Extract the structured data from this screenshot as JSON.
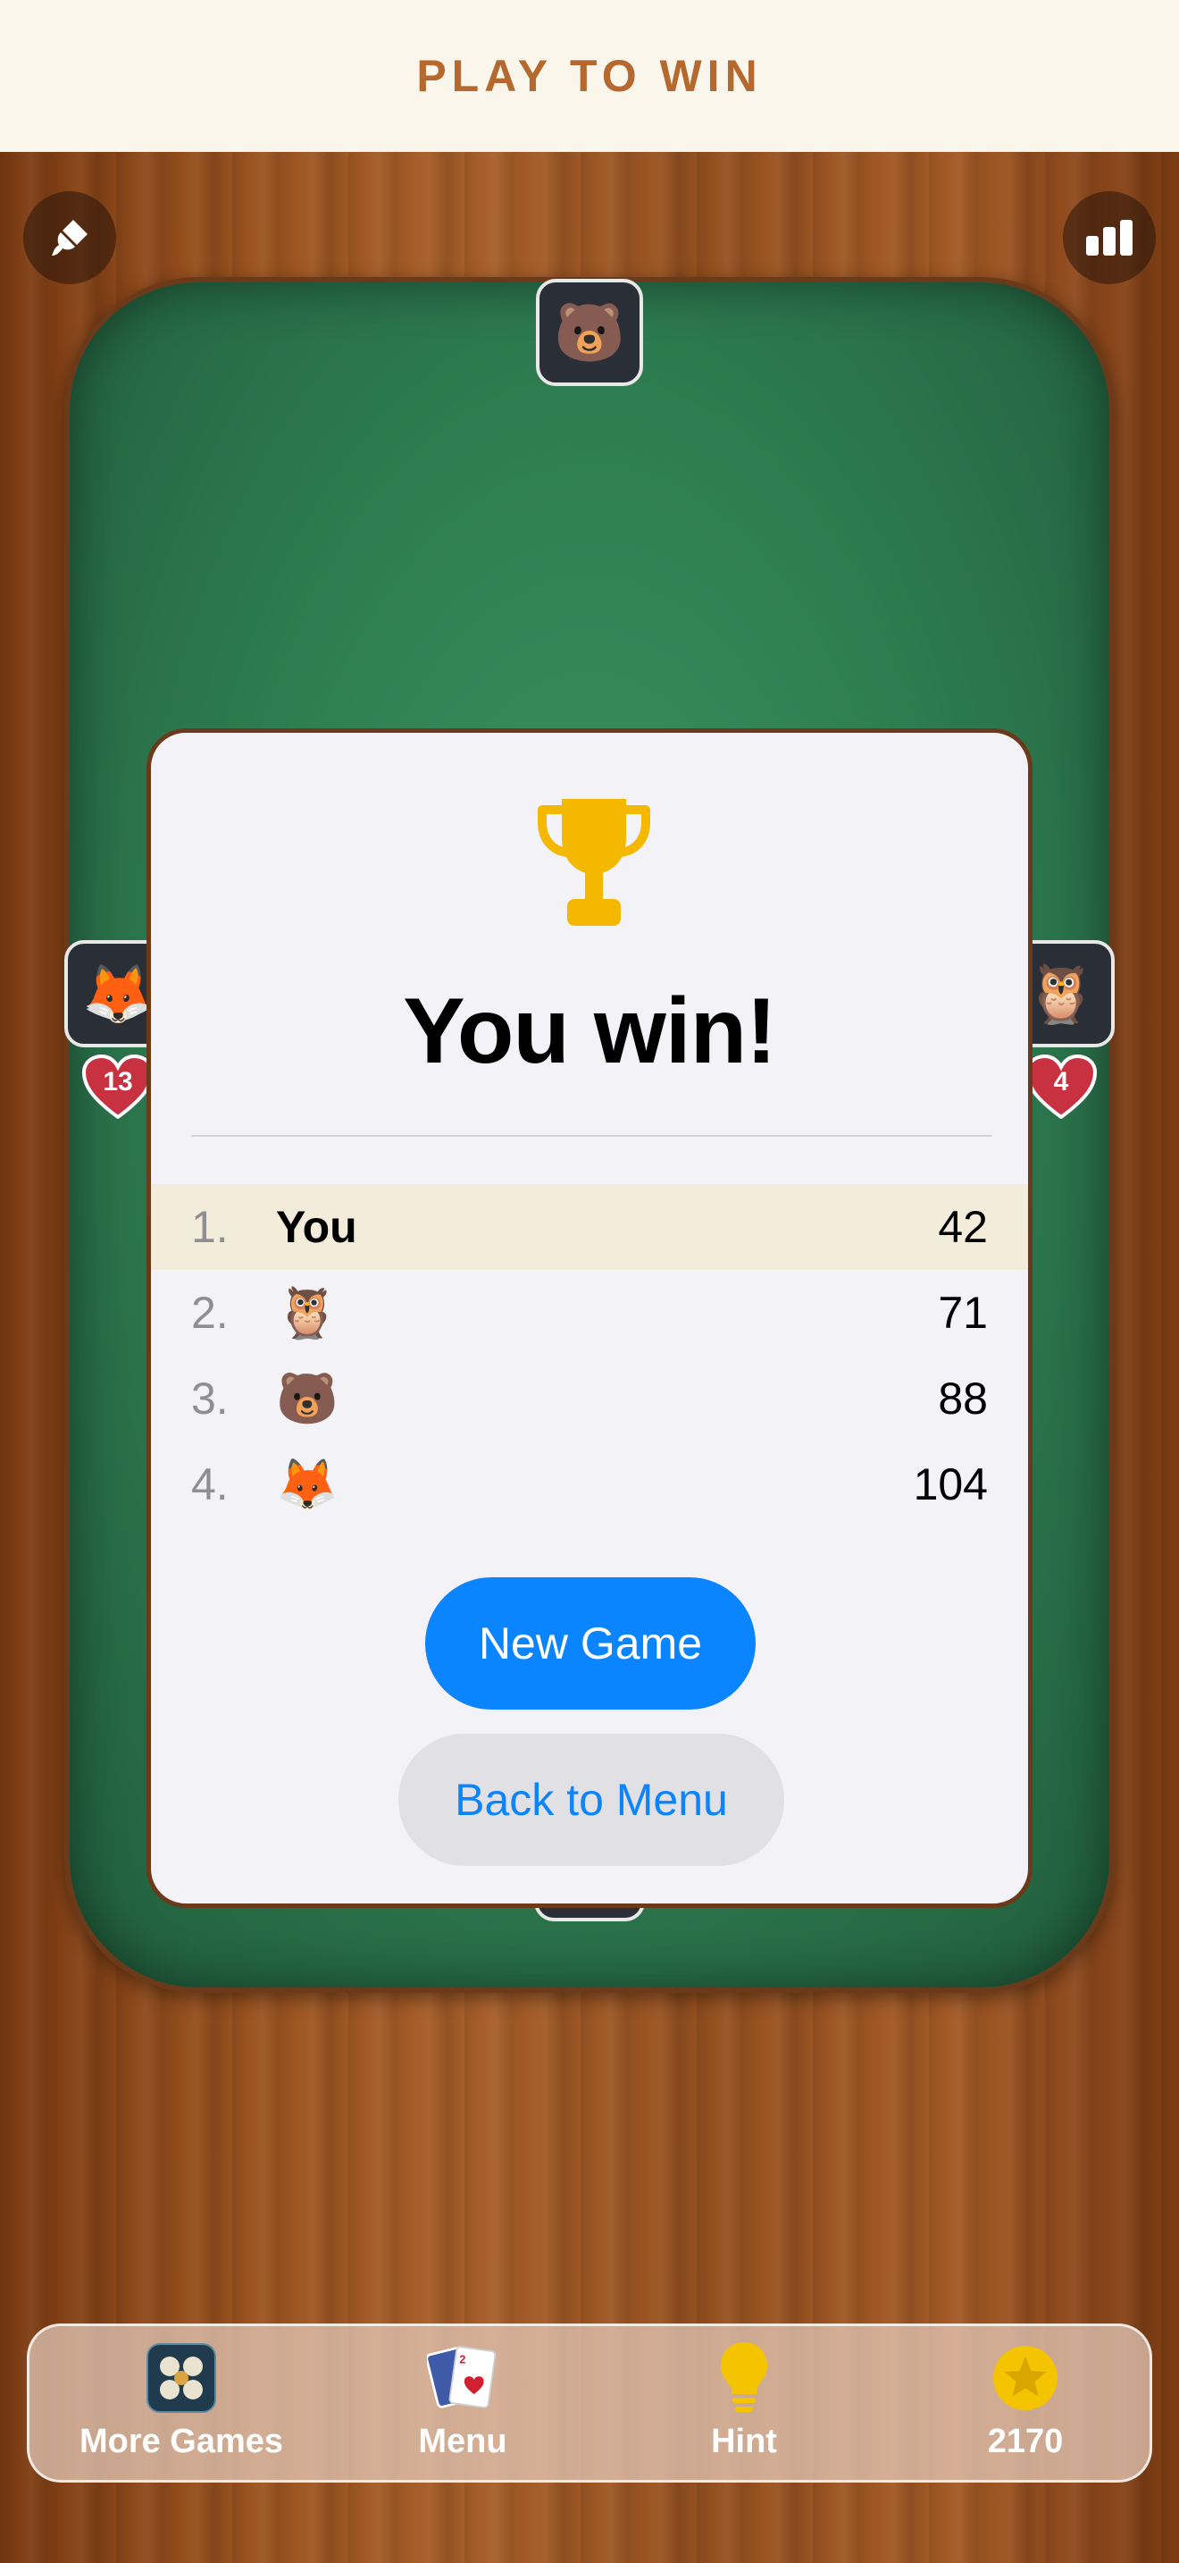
{
  "header": {
    "title": "PLAY TO WIN"
  },
  "table": {
    "top_player": "🐻",
    "left_player": "🦊",
    "right_player": "🦉",
    "left_lives": "13",
    "right_lives": "4"
  },
  "dialog": {
    "title": "You win!",
    "results": [
      {
        "rank": "1.",
        "name": "You",
        "score": "42"
      },
      {
        "rank": "2.",
        "name": "🦉",
        "score": "71"
      },
      {
        "rank": "3.",
        "name": "🐻",
        "score": "88"
      },
      {
        "rank": "4.",
        "name": "🦊",
        "score": "104"
      }
    ],
    "primary_button": "New Game",
    "secondary_button": "Back to Menu"
  },
  "dock": {
    "more_games": "More Games",
    "menu": "Menu",
    "hint": "Hint",
    "coins": "2170"
  },
  "colors": {
    "accent_blue": "#0a84ff",
    "trophy_gold": "#f5b800",
    "felt_green": "#2f7f53",
    "heart_red": "#c8313f",
    "title_brown": "#b5692e"
  }
}
